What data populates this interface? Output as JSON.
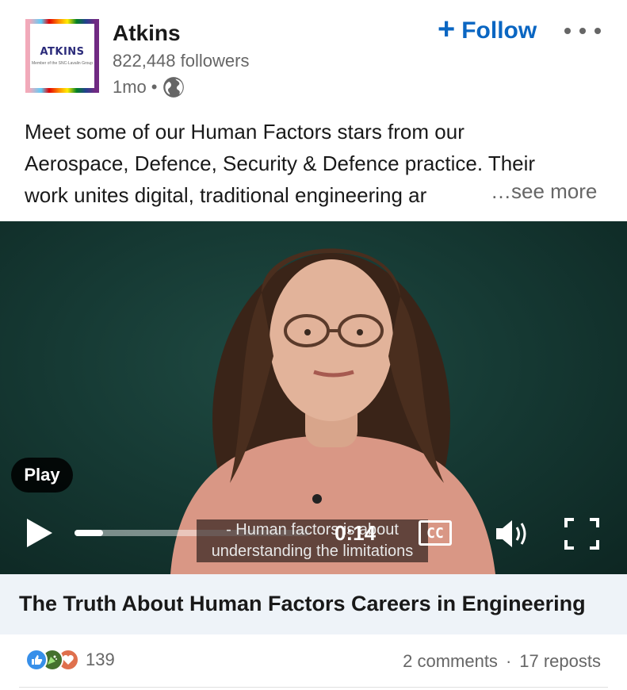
{
  "post": {
    "company_name": "Atkins",
    "followers": "822,448 followers",
    "time_ago": "1mo",
    "separator": "•",
    "follow_plus": "+",
    "follow_label": "Follow",
    "logo_text": "ATKINS",
    "logo_subtext": "Member of the SNC-Lavalin Group",
    "text_lines": [
      "Meet some of our Human Factors stars from our",
      "Aerospace, Defence, Security & Defence practice. Their",
      "work unites digital, traditional engineering ar"
    ],
    "see_more": "…see more"
  },
  "video": {
    "play_label": "Play",
    "time": "0:14",
    "cc_label": "CC",
    "caption_lines": [
      "- Human factors is about",
      "understanding the limitations"
    ],
    "progress": 0.12,
    "title": "The Truth About Human Factors Careers in Engineering"
  },
  "social": {
    "reaction_count": "139",
    "comments": "2 comments",
    "dot": "·",
    "reposts": "17 reposts",
    "reaction_icons": [
      "like-icon",
      "celebrate-icon",
      "love-icon"
    ]
  },
  "colors": {
    "accent": "#0a66c2",
    "muted": "#666666",
    "title_bar": "#eef3f8"
  }
}
